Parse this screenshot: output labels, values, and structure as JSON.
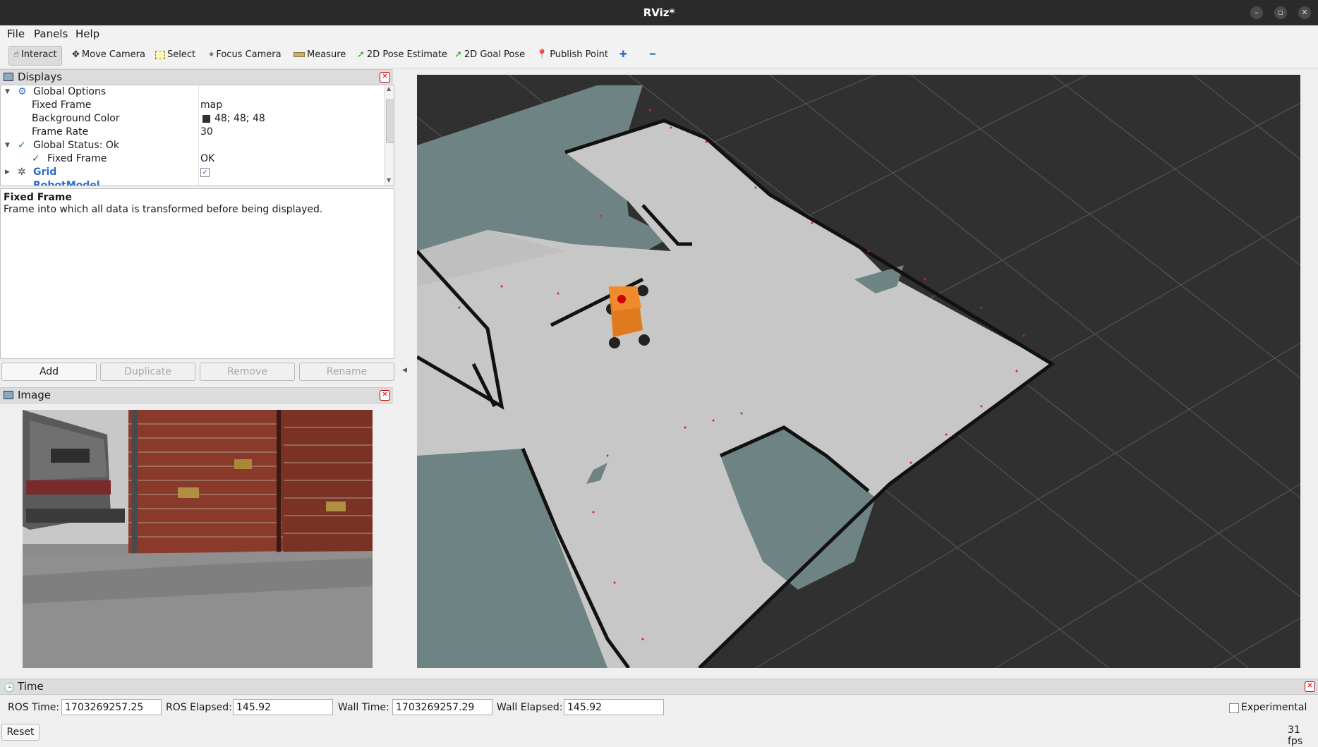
{
  "window": {
    "title": "RViz*"
  },
  "menu": [
    "File",
    "Panels",
    "Help"
  ],
  "toolbar": {
    "interact": "Interact",
    "move_camera": "Move Camera",
    "select": "Select",
    "focus_camera": "Focus Camera",
    "measure": "Measure",
    "pose_estimate": "2D Pose Estimate",
    "goal_pose": "2D Goal Pose",
    "publish_point": "Publish Point"
  },
  "displays": {
    "title": "Displays",
    "rows": [
      {
        "label": "Global Options",
        "value": ""
      },
      {
        "label": "Fixed Frame",
        "value": "map"
      },
      {
        "label": "Background Color",
        "value": "48; 48; 48"
      },
      {
        "label": "Frame Rate",
        "value": "30"
      },
      {
        "label": "Global Status: Ok",
        "value": ""
      },
      {
        "label": "Fixed Frame",
        "value": "OK"
      },
      {
        "label": "Grid",
        "value": ""
      },
      {
        "label": "RobotModel",
        "value": ""
      }
    ],
    "desc_title": "Fixed Frame",
    "desc_text": "Frame into which all data is transformed before being displayed.",
    "buttons": {
      "add": "Add",
      "duplicate": "Duplicate",
      "remove": "Remove",
      "rename": "Rename"
    }
  },
  "image_panel": {
    "title": "Image"
  },
  "time_panel": {
    "title": "Time",
    "ros_time_label": "ROS Time:",
    "ros_time": "1703269257.25",
    "ros_elapsed_label": "ROS Elapsed:",
    "ros_elapsed": "145.92",
    "wall_time_label": "Wall Time:",
    "wall_time": "1703269257.29",
    "wall_elapsed_label": "Wall Elapsed:",
    "wall_elapsed": "145.92",
    "experimental": "Experimental",
    "reset": "Reset",
    "fps": "31 fps"
  },
  "colors": {
    "background": "#303030",
    "accent": "#2a6fc9",
    "robot": "#e07a1f"
  }
}
